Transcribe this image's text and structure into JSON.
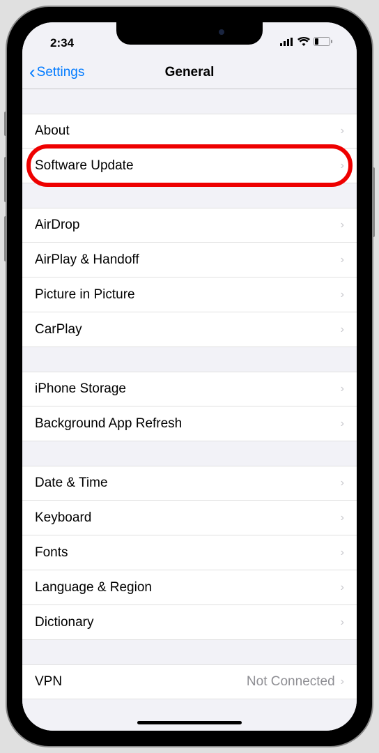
{
  "status": {
    "time": "2:34"
  },
  "nav": {
    "back": "Settings",
    "title": "General"
  },
  "sections": [
    {
      "rows": [
        {
          "label": "About"
        },
        {
          "label": "Software Update",
          "highlighted": true
        }
      ]
    },
    {
      "rows": [
        {
          "label": "AirDrop"
        },
        {
          "label": "AirPlay & Handoff"
        },
        {
          "label": "Picture in Picture"
        },
        {
          "label": "CarPlay"
        }
      ]
    },
    {
      "rows": [
        {
          "label": "iPhone Storage"
        },
        {
          "label": "Background App Refresh"
        }
      ]
    },
    {
      "rows": [
        {
          "label": "Date & Time"
        },
        {
          "label": "Keyboard"
        },
        {
          "label": "Fonts"
        },
        {
          "label": "Language & Region"
        },
        {
          "label": "Dictionary"
        }
      ]
    },
    {
      "rows": [
        {
          "label": "VPN",
          "detail": "Not Connected"
        }
      ]
    }
  ]
}
